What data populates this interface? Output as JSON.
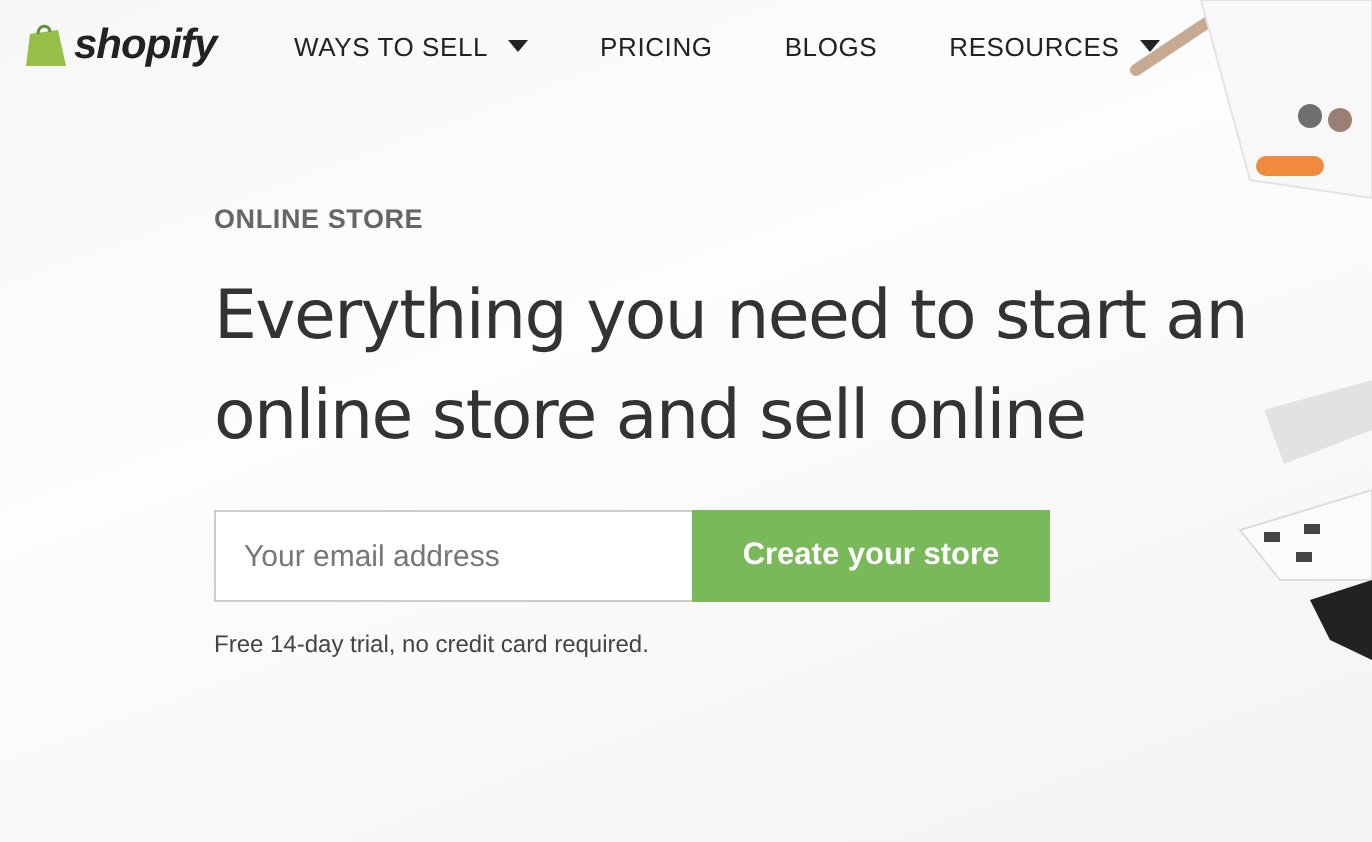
{
  "header": {
    "logo": "shopify",
    "nav": [
      {
        "label": "WAYS TO SELL",
        "dropdown": true
      },
      {
        "label": "PRICING",
        "dropdown": false
      },
      {
        "label": "BLOGS",
        "dropdown": false
      },
      {
        "label": "RESOURCES",
        "dropdown": true
      }
    ]
  },
  "hero": {
    "eyebrow": "ONLINE STORE",
    "headline": "Everything you need to start an online store and sell online",
    "email": {
      "placeholder": "Your email address"
    },
    "button": "Create your store",
    "note": "Free 14-day trial, no credit card required."
  }
}
